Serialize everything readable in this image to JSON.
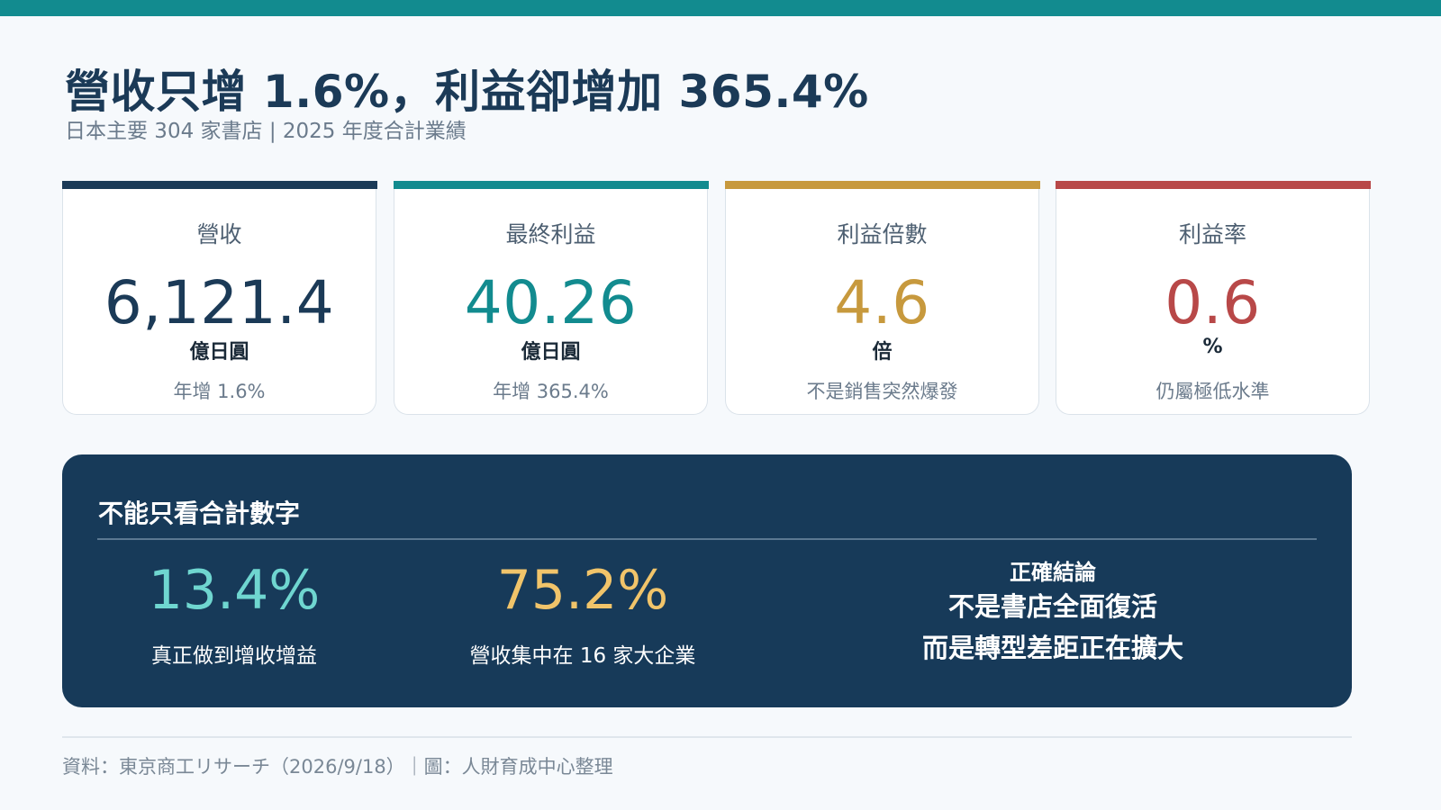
{
  "header": {
    "title": "營收只增 1.6%，利益卻增加 365.4%",
    "subtitle": "日本主要 304 家書店 | 2025 年度合計業績"
  },
  "colors": {
    "accent_teal": "#128b8f",
    "navy": "#1b3a57",
    "gold": "#c7993d",
    "red": "#b84848",
    "panel_bg": "#173a59",
    "stat_teal": "#6fd6d0",
    "stat_gold": "#f1c46a"
  },
  "cards": [
    {
      "label": "營收",
      "value": "6,121.4",
      "unit": "億日圓",
      "note": "年增 1.6%",
      "color": "#1b3a57"
    },
    {
      "label": "最終利益",
      "value": "40.26",
      "unit": "億日圓",
      "note": "年增 365.4%",
      "color": "#128b8f"
    },
    {
      "label": "利益倍數",
      "value": "4.6",
      "unit": "倍",
      "note": "不是銷售突然爆發",
      "color": "#c7993d"
    },
    {
      "label": "利益率",
      "value": "0.6",
      "unit": "%",
      "note": "仍屬極低水準",
      "color": "#b84848"
    }
  ],
  "panel": {
    "title": "不能只看合計數字",
    "stats": [
      {
        "value": "13.4%",
        "label": "真正做到增收增益",
        "color": "#6fd6d0"
      },
      {
        "value": "75.2%",
        "label": "營收集中在 16 家大企業",
        "color": "#f1c46a"
      }
    ],
    "conclusion": {
      "title": "正確結論",
      "lines": [
        "不是書店全面復活",
        "而是轉型差距正在擴大"
      ]
    }
  },
  "footer": {
    "source": "資料：東京商工リサーチ（2026/9/18）｜圖：人財育成中心整理"
  }
}
